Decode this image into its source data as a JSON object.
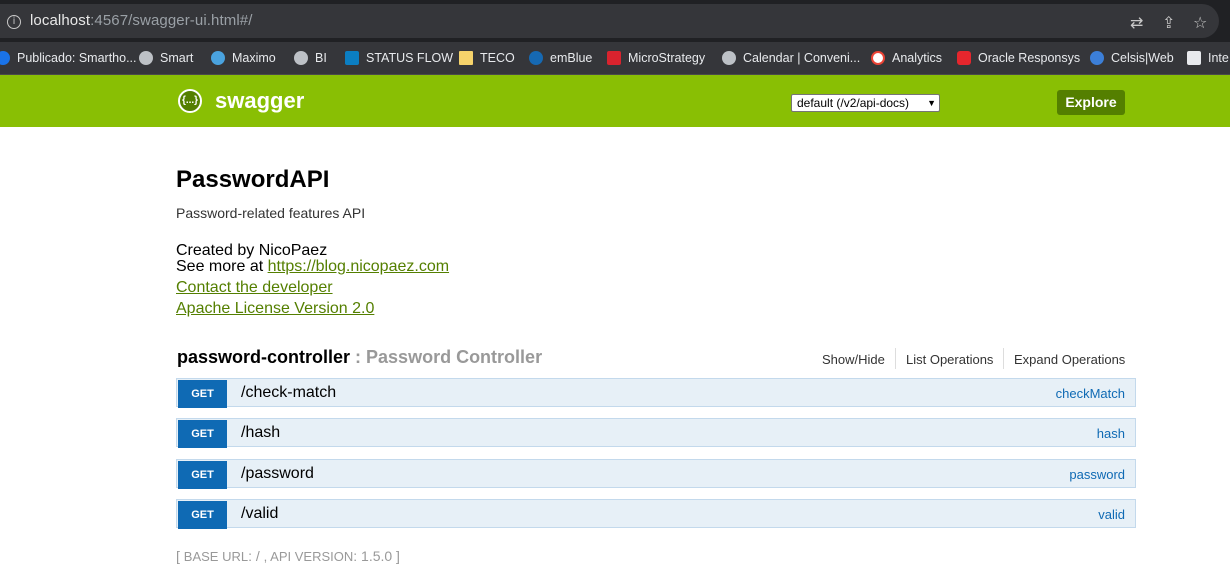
{
  "browser": {
    "url_host": "localhost",
    "url_path": ":4567/swagger-ui.html#/"
  },
  "bookmarks": [
    {
      "label": "Publicado: Smartho...",
      "icon": "bookmark-favicon"
    },
    {
      "label": "Smart",
      "icon": "globe-icon"
    },
    {
      "label": "Maximo",
      "icon": "maximo-icon"
    },
    {
      "label": "BI",
      "icon": "globe-icon"
    },
    {
      "label": "STATUS FLOW",
      "icon": "sharepoint-icon"
    },
    {
      "label": "TECO",
      "icon": "folder-icon"
    },
    {
      "label": "emBlue",
      "icon": "emblue-icon"
    },
    {
      "label": "MicroStrategy",
      "icon": "microstrategy-icon"
    },
    {
      "label": "Calendar | Conveni...",
      "icon": "globe-icon"
    },
    {
      "label": "Analytics",
      "icon": "google-icon"
    },
    {
      "label": "Oracle Responsys",
      "icon": "oracle-icon"
    },
    {
      "label": "Celsis|Web",
      "icon": "celsis-icon"
    },
    {
      "label": "Inte",
      "icon": "intel-icon"
    }
  ],
  "swagger": {
    "logo_text": "swagger",
    "logo_glyph": "{...}",
    "api_select_value": "default (/v2/api-docs)",
    "explore_label": "Explore"
  },
  "info": {
    "title": "PasswordAPI",
    "description": "Password-related features API",
    "created_by": "Created by NicoPaez",
    "see_more_prefix": "See more at ",
    "see_more_link": "https://blog.nicopaez.com",
    "contact_label": "Contact the developer",
    "license_label": "Apache License Version 2.0"
  },
  "controller": {
    "name": "password-controller",
    "separator": " : ",
    "description": "Password Controller",
    "show_hide": "Show/Hide",
    "list_operations": "List Operations",
    "expand_operations": "Expand Operations"
  },
  "operations": [
    {
      "method": "GET",
      "path": "/check-match",
      "operation_id": "checkMatch"
    },
    {
      "method": "GET",
      "path": "/hash",
      "operation_id": "hash"
    },
    {
      "method": "GET",
      "path": "/password",
      "operation_id": "password"
    },
    {
      "method": "GET",
      "path": "/valid",
      "operation_id": "valid"
    }
  ],
  "footer": {
    "open": "[ ",
    "base_url_label": "BASE URL",
    "base_url_value": ": / ",
    "api_version_label": ", API VERSION",
    "api_version_value": ": 1.5.0",
    "close": " ]"
  },
  "colors": {
    "swagger_green": "#89bf04",
    "dark_green": "#547f00",
    "get_blue": "#0f6ab4",
    "op_bg": "#e7f0f7"
  }
}
